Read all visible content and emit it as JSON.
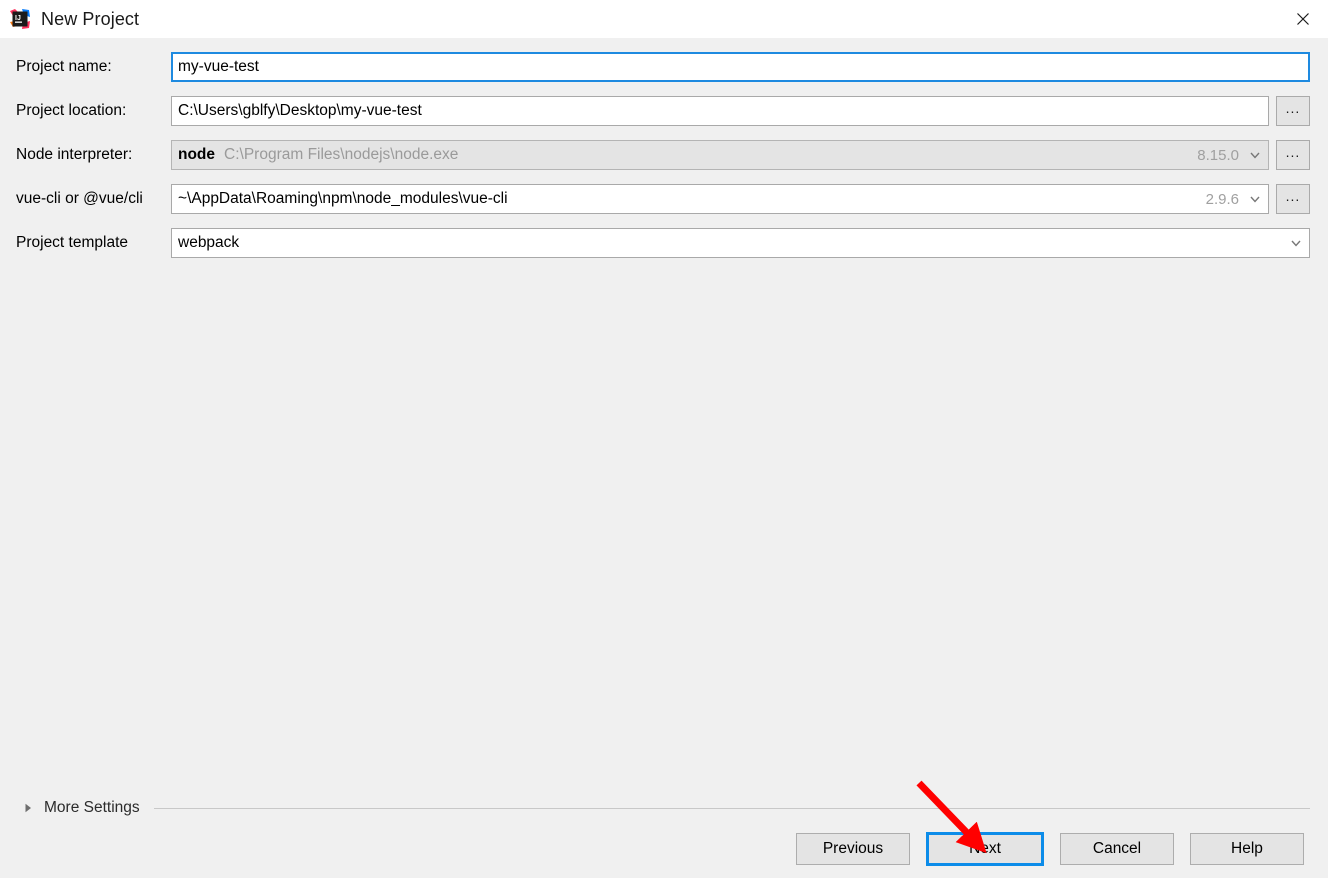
{
  "window": {
    "title": "New Project",
    "app_icon": "intellij-idea-icon",
    "close_icon": "close-icon"
  },
  "form": {
    "rows": [
      {
        "label": "Project name:",
        "value": "my-vue-test",
        "type": "text",
        "focused": true,
        "disabled": false,
        "has_browse": false,
        "browse_label": "",
        "version": "",
        "has_dropdown": false
      },
      {
        "label": "Project location:",
        "value": "C:\\Users\\gblfy\\Desktop\\my-vue-test",
        "type": "text",
        "focused": false,
        "disabled": false,
        "has_browse": true,
        "browse_label": "...",
        "version": "",
        "has_dropdown": false
      },
      {
        "label": "Node interpreter:",
        "value": "node",
        "value_secondary": "C:\\Program Files\\nodejs\\node.exe",
        "type": "text",
        "focused": false,
        "disabled": true,
        "has_browse": true,
        "browse_label": "...",
        "version": "8.15.0",
        "has_dropdown": true
      },
      {
        "label": "vue-cli or @vue/cli",
        "value": "~\\AppData\\Roaming\\npm\\node_modules\\vue-cli",
        "type": "text",
        "focused": false,
        "disabled": false,
        "has_browse": true,
        "browse_label": "...",
        "version": "2.9.6",
        "has_dropdown": true
      },
      {
        "label": "Project template",
        "value": "webpack",
        "type": "combo",
        "focused": false,
        "disabled": false,
        "has_browse": false,
        "browse_label": "",
        "version": "",
        "has_dropdown": true
      }
    ]
  },
  "more_settings": {
    "label": "More Settings",
    "expanded": false,
    "disclosure_icon": "triangle-right-icon"
  },
  "buttons": [
    {
      "label": "Previous",
      "default": false
    },
    {
      "label": "Next",
      "default": true
    },
    {
      "label": "Cancel",
      "default": false
    },
    {
      "label": "Help",
      "default": false
    }
  ],
  "annotation": {
    "type": "arrow",
    "color": "#ff0000",
    "points_to": "Next"
  },
  "colors": {
    "accent": "#0c8ce9",
    "focus_border": "#1e8ae0",
    "background": "#f0f0f0",
    "titlebar": "#ffffff",
    "annotation_red": "#ff0000"
  }
}
